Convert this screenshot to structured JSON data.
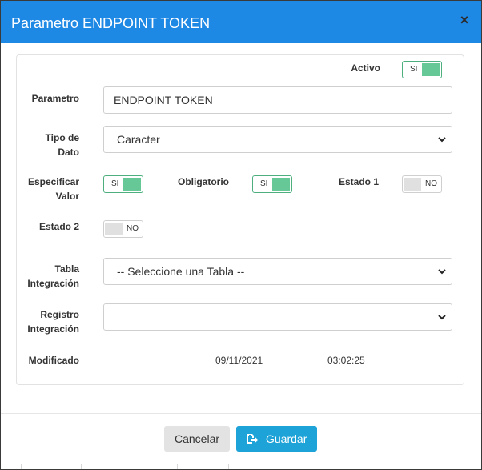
{
  "modal": {
    "title": "Parametro ENDPOINT TOKEN",
    "close_glyph": "×"
  },
  "form": {
    "activo": {
      "label": "Activo",
      "state": "SI",
      "on": true
    },
    "parametro": {
      "label": "Parametro",
      "value": "ENDPOINT TOKEN"
    },
    "tipo_dato": {
      "label": "Tipo de Dato",
      "selected": "Caracter"
    },
    "especificar_valor": {
      "label": "Especificar Valor",
      "state": "SI",
      "on": true
    },
    "obligatorio": {
      "label": "Obligatorio",
      "state": "SI",
      "on": true
    },
    "estado1": {
      "label": "Estado 1",
      "state": "NO",
      "on": false
    },
    "estado2": {
      "label": "Estado 2",
      "state": "NO",
      "on": false
    },
    "tabla_integracion": {
      "label": "Tabla Integración",
      "selected": "-- Seleccione una Tabla --"
    },
    "registro_integracion": {
      "label": "Registro Integración",
      "selected": ""
    },
    "modificado": {
      "label": "Modificado",
      "date": "09/11/2021",
      "time": "03:02:25"
    }
  },
  "footer": {
    "cancel_label": "Cancelar",
    "save_label": "Guardar",
    "save_icon": "floppy-disk-arrow-icon"
  },
  "colors": {
    "header": "#1e88e5",
    "toggle_on": "#66c897",
    "save_button": "#1ea3d8",
    "cancel_button": "#e3e3e3"
  }
}
